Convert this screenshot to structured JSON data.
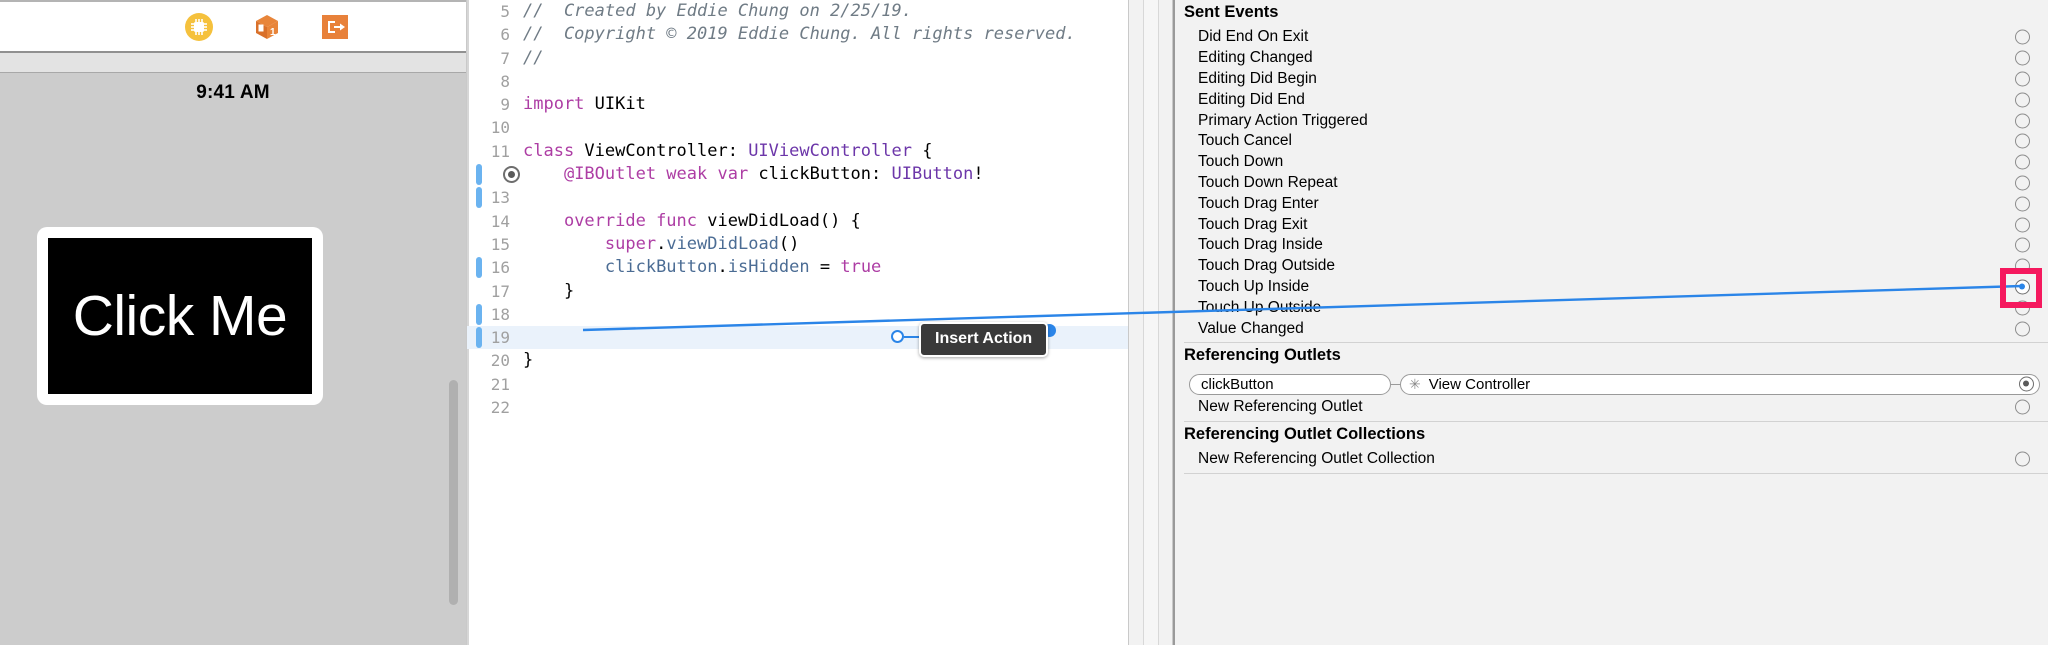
{
  "interface_builder": {
    "toolbar_icons": [
      {
        "name": "simulated-metrics-icon",
        "glyph": "chip"
      },
      {
        "name": "update-frames-icon",
        "glyph": "cube"
      },
      {
        "name": "embed-in-icon",
        "glyph": "embed"
      }
    ],
    "device_status_time": "9:41 AM",
    "button_label": "Click Me"
  },
  "editor": {
    "lines": [
      {
        "num": "5",
        "marker": false,
        "bar": false,
        "highlight": false,
        "tokens": [
          {
            "t": "//  Created by Eddie Chung on 2/25/19.",
            "c": "cmt"
          }
        ]
      },
      {
        "num": "6",
        "marker": false,
        "bar": false,
        "highlight": false,
        "tokens": [
          {
            "t": "//  Copyright © 2019 Eddie Chung. All rights reserved.",
            "c": "cmt"
          }
        ]
      },
      {
        "num": "7",
        "marker": false,
        "bar": false,
        "highlight": false,
        "tokens": [
          {
            "t": "//",
            "c": "cmt"
          }
        ]
      },
      {
        "num": "8",
        "marker": false,
        "bar": false,
        "highlight": false,
        "tokens": []
      },
      {
        "num": "9",
        "marker": false,
        "bar": false,
        "highlight": false,
        "tokens": [
          {
            "t": "import",
            "c": "kw"
          },
          {
            "t": " UIKit",
            "c": "plain"
          }
        ]
      },
      {
        "num": "10",
        "marker": false,
        "bar": false,
        "highlight": false,
        "tokens": []
      },
      {
        "num": "11",
        "marker": false,
        "bar": false,
        "highlight": false,
        "tokens": [
          {
            "t": "class",
            "c": "kw"
          },
          {
            "t": " ViewController: ",
            "c": "plain"
          },
          {
            "t": "UIViewController",
            "c": "type"
          },
          {
            "t": " {",
            "c": "plain"
          }
        ]
      },
      {
        "num": "12",
        "marker": true,
        "bar": true,
        "highlight": false,
        "tokens": [
          {
            "t": "    ",
            "c": "plain"
          },
          {
            "t": "@IBOutlet weak var",
            "c": "kw"
          },
          {
            "t": " clickButton: ",
            "c": "plain"
          },
          {
            "t": "UIButton",
            "c": "type"
          },
          {
            "t": "!",
            "c": "plain"
          }
        ]
      },
      {
        "num": "13",
        "marker": false,
        "bar": true,
        "highlight": false,
        "tokens": []
      },
      {
        "num": "14",
        "marker": false,
        "bar": false,
        "highlight": false,
        "tokens": [
          {
            "t": "    ",
            "c": "plain"
          },
          {
            "t": "override func",
            "c": "kw"
          },
          {
            "t": " viewDidLoad() {",
            "c": "plain"
          }
        ]
      },
      {
        "num": "15",
        "marker": false,
        "bar": false,
        "highlight": false,
        "tokens": [
          {
            "t": "        ",
            "c": "plain"
          },
          {
            "t": "super",
            "c": "kw"
          },
          {
            "t": ".",
            "c": "plain"
          },
          {
            "t": "viewDidLoad",
            "c": "prop"
          },
          {
            "t": "()",
            "c": "plain"
          }
        ]
      },
      {
        "num": "16",
        "marker": false,
        "bar": true,
        "highlight": false,
        "tokens": [
          {
            "t": "        ",
            "c": "plain"
          },
          {
            "t": "clickButton",
            "c": "prop"
          },
          {
            "t": ".",
            "c": "plain"
          },
          {
            "t": "isHidden",
            "c": "prop"
          },
          {
            "t": " = ",
            "c": "plain"
          },
          {
            "t": "true",
            "c": "kw"
          }
        ]
      },
      {
        "num": "17",
        "marker": false,
        "bar": false,
        "highlight": false,
        "tokens": [
          {
            "t": "    }",
            "c": "plain"
          }
        ]
      },
      {
        "num": "18",
        "marker": false,
        "bar": true,
        "highlight": false,
        "tokens": []
      },
      {
        "num": "19",
        "marker": false,
        "bar": true,
        "highlight": true,
        "tokens": []
      },
      {
        "num": "20",
        "marker": false,
        "bar": false,
        "highlight": false,
        "tokens": [
          {
            "t": "}",
            "c": "plain"
          }
        ]
      },
      {
        "num": "21",
        "marker": false,
        "bar": false,
        "highlight": false,
        "tokens": []
      },
      {
        "num": "22",
        "marker": false,
        "bar": false,
        "highlight": false,
        "tokens": []
      }
    ],
    "insert_action_tooltip": "Insert Action"
  },
  "inspector": {
    "sent_events": {
      "title": "Sent Events",
      "items": [
        {
          "label": "Did End On Exit",
          "state": "empty"
        },
        {
          "label": "Editing Changed",
          "state": "empty"
        },
        {
          "label": "Editing Did Begin",
          "state": "empty"
        },
        {
          "label": "Editing Did End",
          "state": "empty"
        },
        {
          "label": "Primary Action Triggered",
          "state": "empty"
        },
        {
          "label": "Touch Cancel",
          "state": "empty"
        },
        {
          "label": "Touch Down",
          "state": "empty"
        },
        {
          "label": "Touch Down Repeat",
          "state": "empty"
        },
        {
          "label": "Touch Drag Enter",
          "state": "empty"
        },
        {
          "label": "Touch Drag Exit",
          "state": "empty"
        },
        {
          "label": "Touch Drag Inside",
          "state": "empty"
        },
        {
          "label": "Touch Drag Outside",
          "state": "empty"
        },
        {
          "label": "Touch Up Inside",
          "state": "active"
        },
        {
          "label": "Touch Up Outside",
          "state": "empty"
        },
        {
          "label": "Value Changed",
          "state": "empty"
        }
      ]
    },
    "referencing_outlets": {
      "title": "Referencing Outlets",
      "outlet_name": "clickButton",
      "outlet_target": "View Controller",
      "outlet_target_icon": "✳",
      "new_outlet_label": "New Referencing Outlet"
    },
    "referencing_outlet_collections": {
      "title": "Referencing Outlet Collections",
      "new_collection_label": "New Referencing Outlet Collection"
    },
    "highlight_color": "#f5195e",
    "drag_line_color": "#2b85e8"
  }
}
